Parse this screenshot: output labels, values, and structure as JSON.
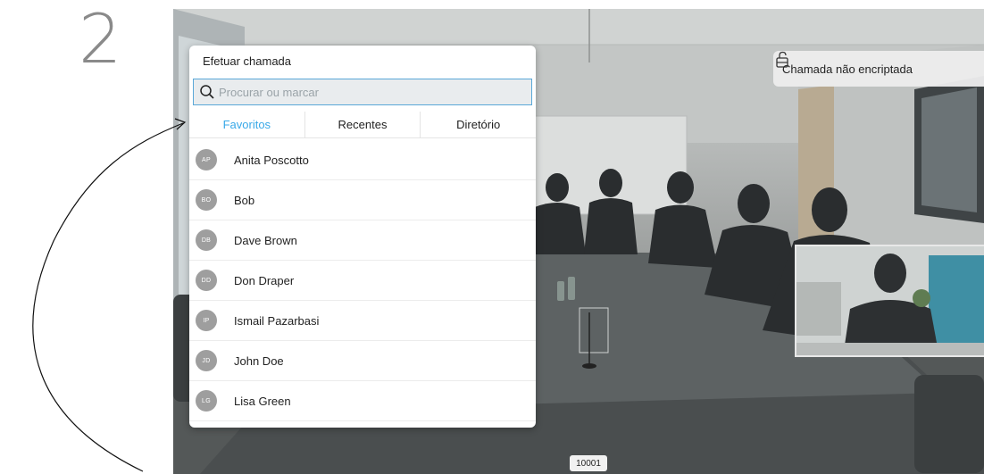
{
  "step": {
    "number": "2"
  },
  "dial_panel": {
    "title": "Efetuar chamada",
    "search": {
      "placeholder": "Procurar ou marcar",
      "value": ""
    },
    "tabs": [
      {
        "label": "Favoritos",
        "active": true
      },
      {
        "label": "Recentes",
        "active": false
      },
      {
        "label": "Diretório",
        "active": false
      }
    ],
    "contacts": [
      {
        "initials": "AP",
        "name": "Anita Poscotto"
      },
      {
        "initials": "BO",
        "name": "Bob"
      },
      {
        "initials": "DB",
        "name": "Dave Brown"
      },
      {
        "initials": "DD",
        "name": "Don Draper"
      },
      {
        "initials": "IP",
        "name": "Ismail Pazarbasi"
      },
      {
        "initials": "JD",
        "name": "John Doe"
      },
      {
        "initials": "LG",
        "name": "Lisa Green"
      }
    ]
  },
  "encryption": {
    "label": "Chamada não encriptada",
    "icon": "unlocked-padlock-icon"
  },
  "call_id": "10001",
  "colors": {
    "accent": "#39a9e8",
    "avatar": "#9e9e9e",
    "search_border": "#5aa8d8"
  }
}
